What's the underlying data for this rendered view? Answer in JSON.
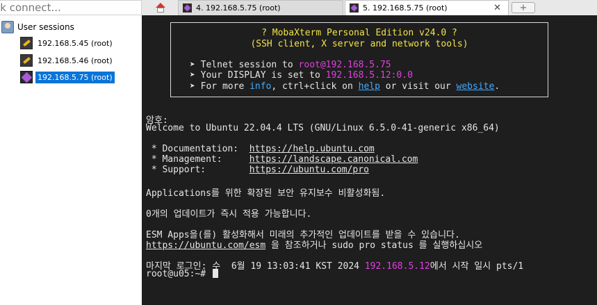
{
  "quick_connect": {
    "value": "ck connect..."
  },
  "sidebar": {
    "root_label": "User sessions",
    "items": [
      {
        "label": "192.168.5.45 (root)",
        "icon": "key-icon"
      },
      {
        "label": "192.168.5.46 (root)",
        "icon": "key-icon"
      },
      {
        "label": "192.168.5.75 (root)",
        "icon": "mobaxterm-session-icon",
        "selected": true
      }
    ]
  },
  "tabs": [
    {
      "label": "4. 192.168.5.75 (root)"
    },
    {
      "label": "5. 192.168.5.75 (root)",
      "close": "✕",
      "active": true
    }
  ],
  "new_tab": "+",
  "terminal": {
    "banner": {
      "title": "? MobaXterm Personal Edition v24.0 ?",
      "subtitle": "(SSH client, X server and network tools)",
      "l1_prefix": "➤ Telnet session to ",
      "l1_host": "root@192.168.5.75",
      "l2_prefix": "➤ Your DISPLAY is set to ",
      "l2_display": "192.168.5.12:0.0",
      "l3_prefix": "➤ For more ",
      "l3_info": "info",
      "l3_mid": ", ctrl+click on ",
      "l3_help": "help",
      "l3_mid2": " or visit our ",
      "l3_website": "website",
      "l3_end": "."
    },
    "password_prompt": "암호:",
    "welcome": "Welcome to Ubuntu 22.04.4 LTS (GNU/Linux 6.5.0-41-generic x86_64)",
    "doc_label": " * Documentation:  ",
    "doc_url": "https://help.ubuntu.com",
    "mgmt_label": " * Management:     ",
    "mgmt_url": "https://landscape.canonical.com",
    "support_label": " * Support:        ",
    "support_url": "https://ubuntu.com/pro",
    "apps_msg": "Applications를 위한 확장된 보안 유지보수 비활성화됨.",
    "updates_msg": "0개의 업데이트가 즉시 적용 가능합니다.",
    "esm_msg": "ESM Apps을(를) 활성화해서 미래의 추가적인 업데이트를 받을 수 있습니다.",
    "esm_url": "https://ubuntu.com/esm",
    "esm_tail": " 을 참조하거나 sudo pro status 를 실행하십시오",
    "last_login_prefix": "마지막 로그인: 수  6월 19 13:03:41 KST 2024 ",
    "last_login_host": "192.168.5.12",
    "last_login_suffix": "에서 시작 일시 pts/1",
    "prompt": "root@u05:~# "
  },
  "colors": {
    "highlight": "#e040e0",
    "link": "#44aaff",
    "banner_text": "#f2e34a",
    "terminal_bg": "#1e1e1e",
    "selection": "#0a74d9"
  }
}
